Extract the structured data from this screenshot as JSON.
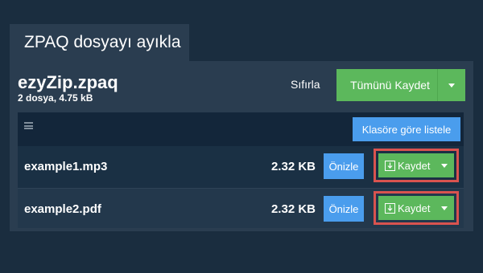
{
  "tab": {
    "title": "ZPAQ dosyayı ayıkla"
  },
  "archive": {
    "name": "ezyZip.zpaq",
    "summary": "2 dosya, 4.75 kB"
  },
  "toolbar": {
    "reset_label": "Sıfırla",
    "save_all_label": "Tümünü Kaydet",
    "list_by_folder_label": "Klasöre göre listele"
  },
  "files": [
    {
      "name": "example1.mp3",
      "size": "2.32 KB",
      "preview_label": "Önizle",
      "save_label": "Kaydet"
    },
    {
      "name": "example2.pdf",
      "size": "2.32 KB",
      "preview_label": "Önizle",
      "save_label": "Kaydet"
    }
  ],
  "colors": {
    "background": "#1a2d3f",
    "panel": "#2a3d50",
    "green": "#5cb85c",
    "blue": "#4a9ded",
    "highlight": "#d9534f"
  }
}
